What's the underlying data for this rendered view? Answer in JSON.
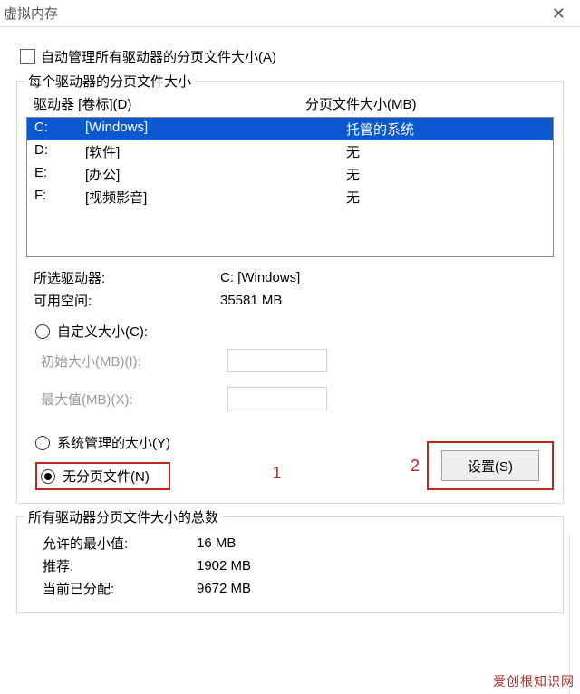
{
  "titlebar": {
    "title": "虚拟内存"
  },
  "auto_manage": {
    "label": "自动管理所有驱动器的分页文件大小(A)",
    "checked": false
  },
  "group_each": {
    "title": "每个驱动器的分页文件大小",
    "col_drive": "驱动器 [卷标](D)",
    "col_page": "分页文件大小(MB)",
    "rows": [
      {
        "drive": "C:",
        "label": "[Windows]",
        "page": "托管的系统",
        "selected": true
      },
      {
        "drive": "D:",
        "label": "[软件]",
        "page": "无",
        "selected": false
      },
      {
        "drive": "E:",
        "label": "[办公]",
        "page": "无",
        "selected": false
      },
      {
        "drive": "F:",
        "label": "[视频影音]",
        "page": "无",
        "selected": false
      }
    ],
    "selected_drive_label": "所选驱动器:",
    "selected_drive_value": "C:  [Windows]",
    "free_space_label": "可用空间:",
    "free_space_value": "35581 MB",
    "radio_custom": "自定义大小(C):",
    "init_label": "初始大小(MB)(I):",
    "max_label": "最大值(MB)(X):",
    "radio_system": "系统管理的大小(Y)",
    "radio_none": "无分页文件(N)",
    "set_button": "设置(S)",
    "ann1": "1",
    "ann2": "2"
  },
  "group_total": {
    "title": "所有驱动器分页文件大小的总数",
    "min_label": "允许的最小值:",
    "min_value": "16 MB",
    "rec_label": "推荐:",
    "rec_value": "1902 MB",
    "cur_label": "当前已分配:",
    "cur_value": "9672 MB"
  },
  "watermark": "爱创根知识网"
}
